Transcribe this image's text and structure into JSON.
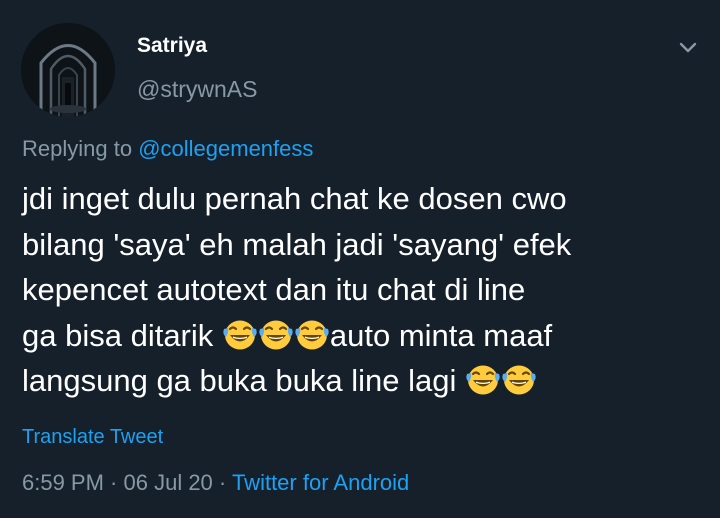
{
  "author": {
    "display_name": "Satriya",
    "handle": "@strywnAS"
  },
  "reply": {
    "prefix": "Replying to ",
    "mention": "@collegemenfess"
  },
  "tweet": {
    "lines": [
      "jdi inget dulu pernah chat ke dosen cwo",
      "bilang 'saya' eh malah jadi 'sayang' efek",
      "kepencet autotext dan itu chat di line",
      "ga bisa ditarik ",
      "auto minta maaf",
      "langsung ga buka buka line lagi "
    ],
    "emoji": "face-with-tears-of-joy-icon"
  },
  "translate_label": "Translate Tweet",
  "meta": {
    "time": "6:59 PM",
    "separator": " · ",
    "date": "06 Jul 20",
    "source": "Twitter for Android"
  },
  "colors": {
    "background": "#15202b",
    "text": "#ffffff",
    "secondary": "#8899a6",
    "accent": "#1da1f2"
  },
  "icons": {
    "menu": "chevron-down-icon"
  }
}
